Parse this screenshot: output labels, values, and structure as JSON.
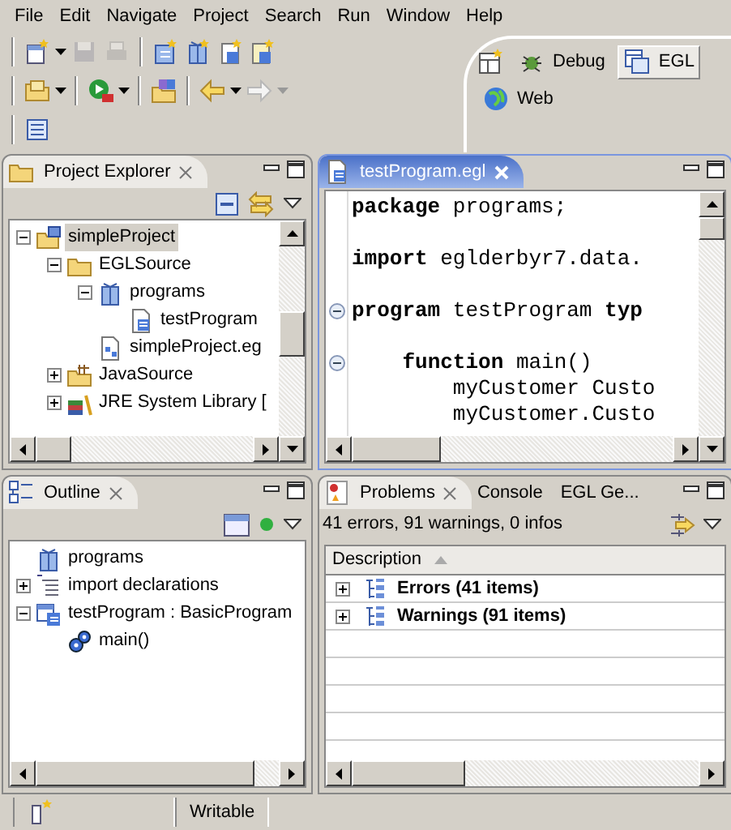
{
  "menu": [
    "File",
    "Edit",
    "Navigate",
    "Project",
    "Search",
    "Run",
    "Window",
    "Help"
  ],
  "perspectives": [
    {
      "label": "Debug",
      "selected": false
    },
    {
      "label": "EGL",
      "selected": true
    },
    {
      "label": "Web",
      "selected": false
    }
  ],
  "project_explorer": {
    "title": "Project Explorer",
    "tree": [
      {
        "kind": "project",
        "label": "simpleProject",
        "selected": true,
        "expanded": true,
        "children": [
          {
            "kind": "source-folder",
            "label": "EGLSource",
            "selected": false,
            "expanded": true,
            "children": [
              {
                "kind": "package",
                "label": "programs",
                "selected": false,
                "expanded": true,
                "children": [
                  {
                    "kind": "egl-file",
                    "label": "testProgram",
                    "selected": false
                  }
                ]
              },
              {
                "kind": "build-file",
                "label": "simpleProject.eg",
                "selected": false
              }
            ]
          },
          {
            "kind": "java-folder",
            "label": "JavaSource",
            "selected": false,
            "expanded": false
          },
          {
            "kind": "library",
            "label": "JRE System Library [",
            "selected": false,
            "expanded": false
          }
        ]
      }
    ]
  },
  "editor": {
    "tab": "testProgram.egl",
    "lines": [
      {
        "kind": "code",
        "text": "**package** programs;",
        "fold": false
      },
      {
        "kind": "blank"
      },
      {
        "kind": "code",
        "text": "**import** eglderbyr7.data.",
        "fold": false
      },
      {
        "kind": "blank"
      },
      {
        "kind": "code",
        "text": "**program** testProgram **typ**",
        "fold": true
      },
      {
        "kind": "blank"
      },
      {
        "kind": "code",
        "text": "    **function** main()",
        "fold": true
      },
      {
        "kind": "code",
        "text": "        myCustomer Custo",
        "fold": false
      },
      {
        "kind": "code",
        "text": "        myCustomer.Custo",
        "fold": false
      }
    ]
  },
  "outline": {
    "title": "Outline",
    "tree": [
      {
        "kind": "package",
        "label": "programs"
      },
      {
        "kind": "imports",
        "label": "import declarations",
        "expanded": false
      },
      {
        "kind": "program",
        "label": "testProgram : BasicProgram",
        "expanded": true,
        "children": [
          {
            "kind": "function",
            "label": "main()"
          }
        ]
      }
    ]
  },
  "problems": {
    "tabs": [
      {
        "label": "Problems",
        "selected": true
      },
      {
        "label": "Console",
        "selected": false
      },
      {
        "label": "EGL Ge...",
        "selected": false
      }
    ],
    "summary": "41 errors, 91 warnings, 0 infos",
    "columns": [
      "Description"
    ],
    "rows": [
      {
        "label": "Errors (41 items)",
        "expanded": false
      },
      {
        "label": "Warnings (91 items)",
        "expanded": false
      }
    ]
  },
  "status_bar": {
    "mode": "Writable"
  }
}
